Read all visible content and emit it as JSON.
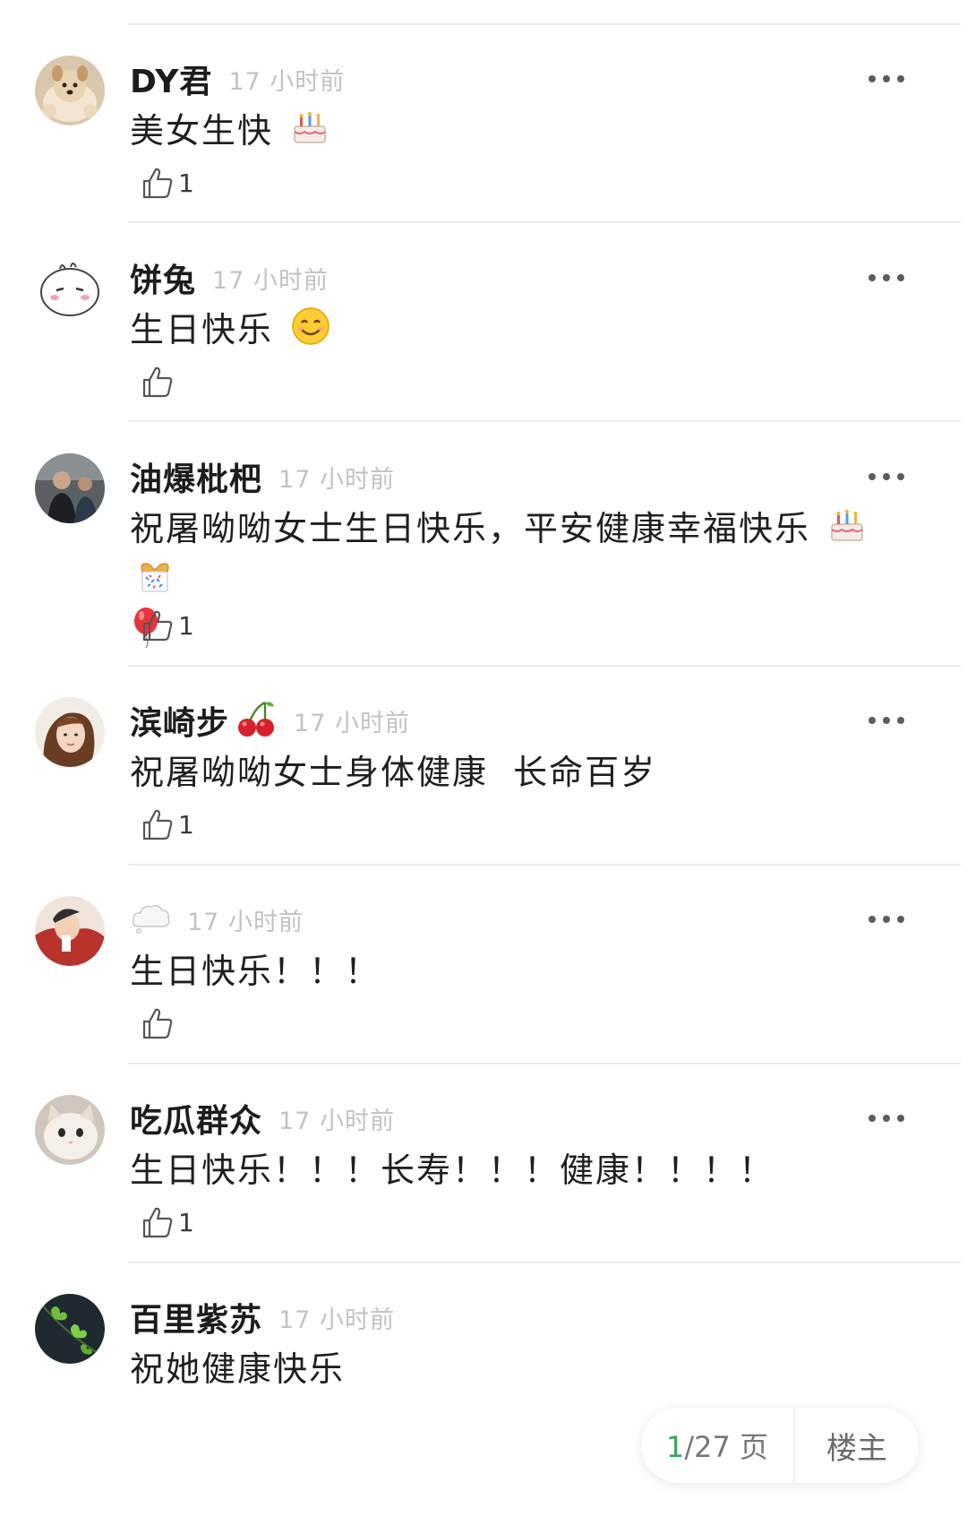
{
  "comments": [
    {
      "username": "DY君",
      "time": "17 小时前",
      "text": "美女生快",
      "likes": "1",
      "avatar_icon": "dog-photo-icon",
      "emojis": [
        "birthday-cake-icon"
      ]
    },
    {
      "username": "饼兔",
      "time": "17 小时前",
      "text": "生日快乐",
      "likes": "",
      "avatar_icon": "bun-rabbit-icon",
      "emojis": [
        "smiling-face-icon"
      ]
    },
    {
      "username": "油爆枇杷",
      "time": "17 小时前",
      "text": "祝屠呦呦女士生日快乐，平安健康幸福快乐",
      "likes": "1",
      "avatar_icon": "person-photo-icon",
      "emojis": [
        "birthday-cake-icon",
        "gift-icon",
        "balloon-icon"
      ]
    },
    {
      "username": "滨崎步",
      "time": "17 小时前",
      "text": "祝屠呦呦女士身体健康  长命百岁",
      "likes": "1",
      "avatar_icon": "woman-photo-icon",
      "emojis": []
    },
    {
      "username": "",
      "time": "17 小时前",
      "text": "生日快乐！！！",
      "likes": "",
      "avatar_icon": "cartoon-avatar-icon",
      "emojis": []
    },
    {
      "username": "吃瓜群众",
      "time": "17 小时前",
      "text": "生日快乐！！！长寿！！！健康！！！！",
      "likes": "1",
      "avatar_icon": "cat-photo-icon",
      "emojis": []
    },
    {
      "username": "百里紫苏",
      "time": "17 小时前",
      "text": "祝她健康快乐",
      "likes": "",
      "avatar_icon": "heart-leaves-icon",
      "emojis": []
    }
  ],
  "pager": {
    "current": "1",
    "total": "/27 页",
    "owner_label": "楼主"
  }
}
